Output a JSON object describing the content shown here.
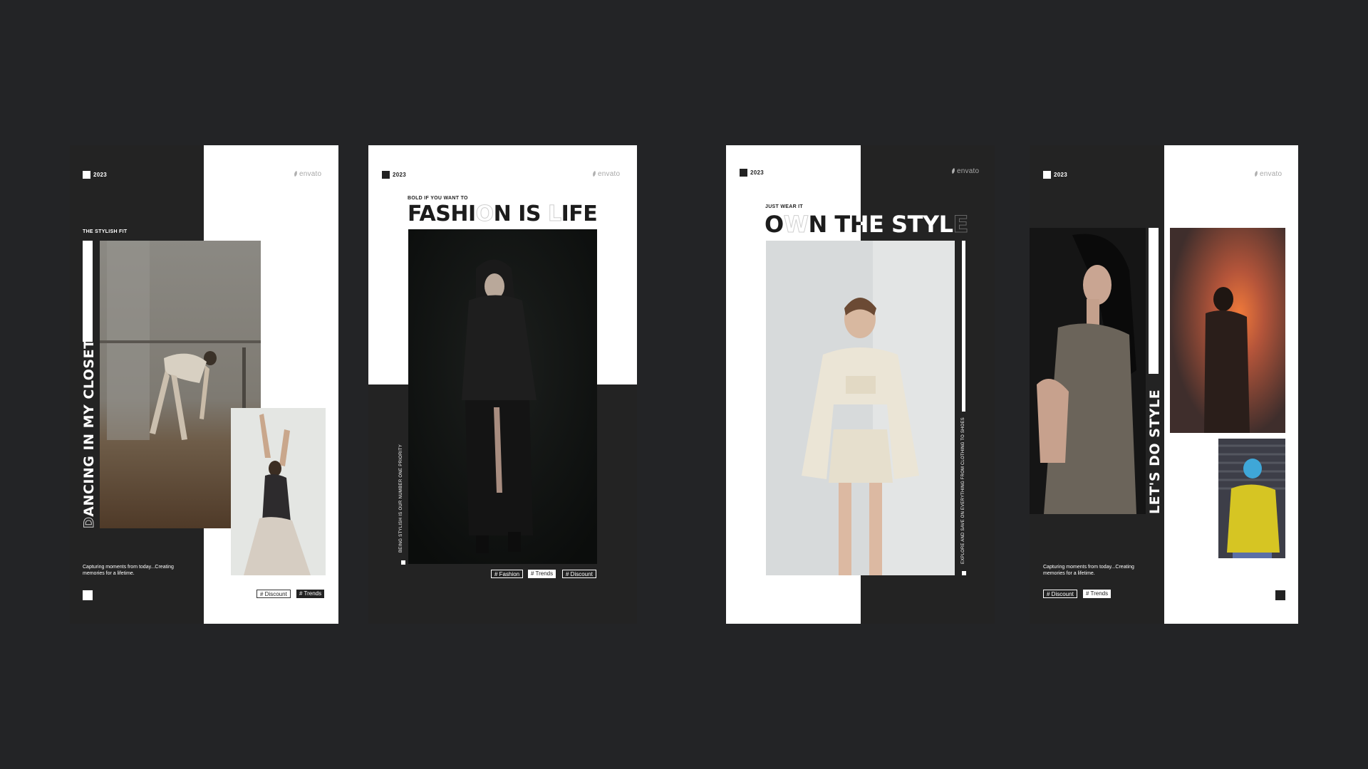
{
  "cards": [
    {
      "year": "2023",
      "brand": "envato",
      "kicker": "THE STYLISH FIT",
      "vertical_title_first": "D",
      "vertical_title_rest": "ANCING IN MY CLOSET",
      "caption": "Capturing moments from today...Creating memories for a lifetime.",
      "tags": [
        "# Discount",
        "# Trends"
      ]
    },
    {
      "year": "2023",
      "brand": "envato",
      "kicker": "BOLD IF YOU WANT TO",
      "headline_parts": [
        "FASHI",
        "O",
        "N IS ",
        "L",
        "IFE"
      ],
      "vertical_text": "BEING STYLISH IS OUR NUMBER ONE PRIORITY",
      "tags": [
        "# Fashion",
        "# Trends",
        "# Discount"
      ]
    },
    {
      "year": "2023",
      "brand": "envato",
      "kicker": "JUST WEAR IT",
      "headline_parts": [
        "O",
        "W",
        "N THE STYL",
        "E"
      ],
      "vertical_text": "EXPLORE AND SAVE ON EVERYTHING FROM CLOTHING TO SHOES"
    },
    {
      "year": "2023",
      "brand": "envato",
      "vertical_title": "LET'S DO STYLE",
      "caption": "Capturing moments from today...Creating memories for a lifetime.",
      "tags": [
        "# Discount",
        "# Trends"
      ]
    }
  ],
  "colors": {
    "background": "#232426",
    "card_dark": "#232323",
    "card_light": "#ffffff"
  },
  "photos": [
    "ballet-dancer-photo",
    "dancer-arms-raised-photo",
    "black-hoodie-model-photo",
    "cream-outfit-model-photo",
    "woman-profile-photo",
    "man-orange-light-photo",
    "yellow-hoodie-photo"
  ]
}
